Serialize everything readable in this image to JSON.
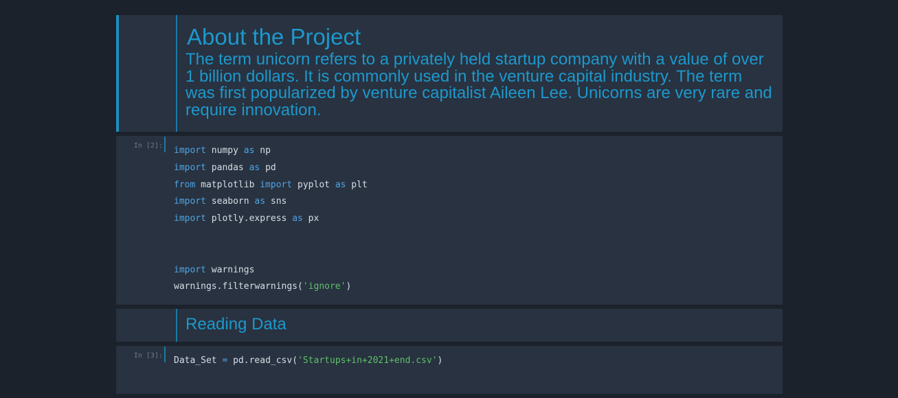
{
  "cells": {
    "about": {
      "title": "About the Project",
      "body": "The term unicorn refers to a privately held startup company with a value of over 1 billion dollars. It is commonly used in the venture capital industry. The term was first popularized by venture capitalist Aileen Lee. Unicorns are very rare and require innovation."
    },
    "imports": {
      "prompt": "In [2]:",
      "lines": [
        [
          {
            "t": "import",
            "c": "kw"
          },
          {
            "t": " numpy ",
            "c": ""
          },
          {
            "t": "as",
            "c": "kw"
          },
          {
            "t": " np",
            "c": ""
          }
        ],
        [
          {
            "t": "import",
            "c": "kw"
          },
          {
            "t": " pandas ",
            "c": ""
          },
          {
            "t": "as",
            "c": "kw"
          },
          {
            "t": " pd",
            "c": ""
          }
        ],
        [
          {
            "t": "from",
            "c": "kw"
          },
          {
            "t": " matplotlib ",
            "c": ""
          },
          {
            "t": "import",
            "c": "kw"
          },
          {
            "t": " pyplot ",
            "c": ""
          },
          {
            "t": "as",
            "c": "kw"
          },
          {
            "t": " plt",
            "c": ""
          }
        ],
        [
          {
            "t": "import",
            "c": "kw"
          },
          {
            "t": " seaborn ",
            "c": ""
          },
          {
            "t": "as",
            "c": "kw"
          },
          {
            "t": " sns",
            "c": ""
          }
        ],
        [
          {
            "t": "import",
            "c": "kw"
          },
          {
            "t": " plotly.express ",
            "c": ""
          },
          {
            "t": "as",
            "c": "kw"
          },
          {
            "t": " px",
            "c": ""
          }
        ],
        [],
        [],
        [
          {
            "t": "import",
            "c": "kw"
          },
          {
            "t": " warnings",
            "c": ""
          }
        ],
        [
          {
            "t": "warnings.filterwarnings(",
            "c": ""
          },
          {
            "t": "'ignore'",
            "c": "str"
          },
          {
            "t": ")",
            "c": ""
          }
        ]
      ]
    },
    "reading": {
      "title": "Reading Data"
    },
    "read_csv": {
      "prompt": "In [3]:",
      "lines": [
        [
          {
            "t": "Data_Set ",
            "c": ""
          },
          {
            "t": "=",
            "c": "op"
          },
          {
            "t": " pd.read_csv(",
            "c": ""
          },
          {
            "t": "'Startups+in+2021+end.csv'",
            "c": "str"
          },
          {
            "t": ")",
            "c": ""
          }
        ]
      ]
    }
  }
}
